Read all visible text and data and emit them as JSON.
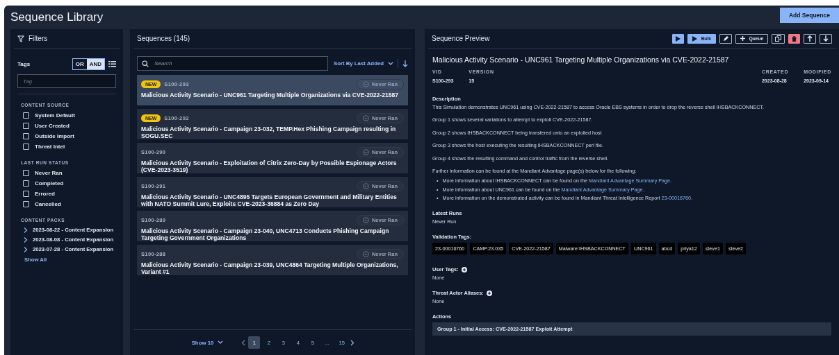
{
  "header": {
    "title": "Sequence Library",
    "add_button": "Add Sequence"
  },
  "filters": {
    "title": "Filters",
    "tags_label": "Tags",
    "tag_modes": [
      {
        "label": "OR",
        "selected": false
      },
      {
        "label": "AND",
        "selected": true
      }
    ],
    "tag_placeholder": "Tag",
    "sections": [
      {
        "title": "CONTENT SOURCE",
        "options": [
          {
            "label": "System Default",
            "checked": false
          },
          {
            "label": "User Created",
            "checked": false
          },
          {
            "label": "Outside Import",
            "checked": false
          },
          {
            "label": "Threat Intel",
            "checked": false
          }
        ]
      },
      {
        "title": "LAST RUN STATUS",
        "options": [
          {
            "label": "Never Ran",
            "checked": false
          },
          {
            "label": "Completed",
            "checked": false
          },
          {
            "label": "Errored",
            "checked": false
          },
          {
            "label": "Cancelled",
            "checked": false
          }
        ]
      }
    ],
    "packs_title": "CONTENT PACKS",
    "packs": [
      {
        "label": "2023-08-22 - Content Expansion",
        "expanded": false
      },
      {
        "label": "2023-08-08 - Content Expansion",
        "expanded": false
      },
      {
        "label": "2023-07-28 - Content Expansion",
        "expanded": false
      }
    ],
    "show_all": "Show All"
  },
  "sequences": {
    "title": "Sequences (145)",
    "search_placeholder": "Search",
    "sort": "Sort By Last Added",
    "items": [
      {
        "badge": "NEW",
        "id": "S100-293",
        "status": "Never Ran",
        "title": "Malicious Activity Scenario - UNC961 Targeting Multiple Organizations via CVE-2022-21587",
        "selected": true
      },
      {
        "badge": "NEW",
        "id": "S100-292",
        "status": "Never Ran",
        "title": "Malicious Activity Scenario - Campaign 23-032, TEMP.Hex Phishing Campaign resulting in SOGU.SEC",
        "selected": false
      },
      {
        "id": "S100-290",
        "status": "Never Ran",
        "title": "Malicious Activity Scenario - Exploitation of Citrix Zero-Day by Possible Espionage Actors (CVE-2023-3519)",
        "selected": false
      },
      {
        "id": "S100-291",
        "status": "Never Ran",
        "title": "Malicious Activity Scenario - UNC4895 Targets European Government and Military Entities with NATO Summit Lure, Exploits CVE-2023-36884 as Zero Day",
        "selected": false
      },
      {
        "id": "S100-289",
        "status": "Never Ran",
        "title": "Malicious Activity Scenario - Campaign 23-040, UNC4713 Conducts Phishing Campaign Targeting Government Organizations",
        "selected": false
      },
      {
        "id": "S100-288",
        "status": "Never Ran",
        "title": "Malicious Activity Scenario - Campaign 23-039, UNC4864 Targeting Multiple Organizations, Variant #1",
        "selected": false
      }
    ],
    "page_size": "Show 10",
    "pages": [
      {
        "label": "1",
        "selected": true
      },
      {
        "label": "2",
        "selected": false
      },
      {
        "label": "3",
        "selected": false
      },
      {
        "label": "4",
        "selected": false
      },
      {
        "label": "5",
        "selected": false
      },
      {
        "label": "...",
        "selected": false
      },
      {
        "label": "15",
        "selected": false
      }
    ]
  },
  "preview": {
    "title": "Sequence Preview",
    "bulk": "Bulk",
    "queue": "Queue",
    "name": "Malicious Activity Scenario - UNC961 Targeting Multiple Organizations via CVE-2022-21587",
    "meta": [
      {
        "label": "VID",
        "value": "S100-293"
      },
      {
        "label": "VERSION",
        "value": "15"
      },
      {
        "label": "CREATED",
        "value": "2023-08-28"
      },
      {
        "label": "MODIFIED",
        "value": "2023-09-14"
      }
    ],
    "description_label": "Description",
    "paragraphs": [
      "This Simulation demonstrates UNC961 using CVE-2022-21587 to access Oracle EBS systems in order to drop the reverse shell IHSBACKCONNECT.",
      "Group 1 shows several variations to attempt to exploit CVE-2022-21587.",
      "Group 2 shows IHSBACKCONNECT being transfered onto an exploited host",
      "Group 3 shows the host executing the resulting IHSBACKCONNECT perl file.",
      "Group 4 shows the resulting command and control traffic from the reverse shell.",
      "Further information can be found at the Mandiant Advantage page(s) below for the following:"
    ],
    "bullets": [
      {
        "marker": "•",
        "text": "More information about IHSBACKCONNECT can be found on the ",
        "link": "Mandiant Advantage Summary Page",
        "after": "."
      },
      {
        "marker": "•",
        "text": "More information about UNC961 can be found on the ",
        "link": "Mandiant Advantage Summary Page",
        "after": "."
      },
      {
        "marker": "•",
        "text": "More information on the demonstrated activity can be found in Mandiant Threat Intelligence Report ",
        "link": "23-00016760",
        "after": "."
      }
    ],
    "latest_runs_label": "Latest Runs",
    "latest_runs": "Never Run",
    "validation_tags_label": "Validation Tags:",
    "validation_tags": [
      "23-00016760",
      "CAMP.23.035",
      "CVE-2022-21587",
      "Malware:IHSBACKCONNECT",
      "UNC961",
      "abcd",
      "priya12",
      "steve1",
      "steve2"
    ],
    "user_tags_label": "User Tags:",
    "user_tags": "None",
    "aliases_label": "Threat Actor Aliases:",
    "aliases": "None",
    "actions_label": "Actions",
    "action_groups": [
      "Group 1 - Initial Access: CVE-2022-21587 Exploit Attempt"
    ]
  }
}
